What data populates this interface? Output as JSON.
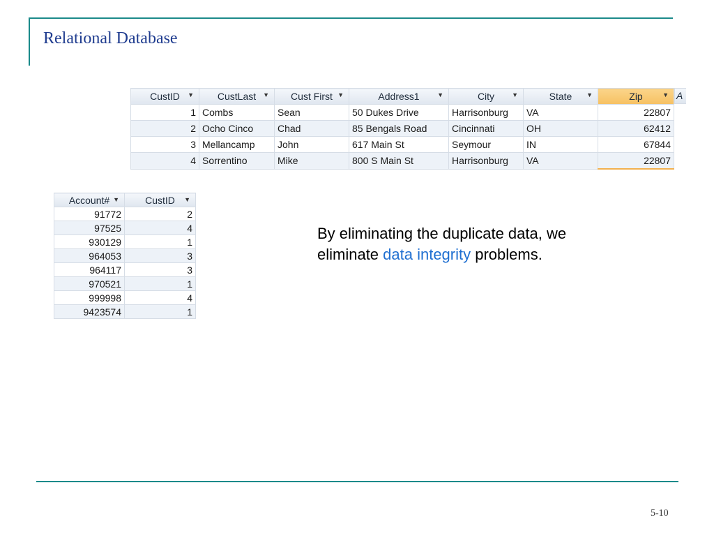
{
  "slide": {
    "title": "Relational Database",
    "page_number": "5-10",
    "note_before": "By eliminating the duplicate data, we eliminate ",
    "note_highlight": "data integrity",
    "note_after": " problems.",
    "accent_color": "#1b8a8a",
    "highlight_color": "#1f6fd1"
  },
  "customers": {
    "headers": [
      "CustID",
      "CustLast",
      "Cust First",
      "Address1",
      "City",
      "State",
      "Zip"
    ],
    "cut_header": "A",
    "rows": [
      [
        "1",
        "Combs",
        "Sean",
        "50 Dukes Drive",
        "Harrisonburg",
        "VA",
        "22807"
      ],
      [
        "2",
        "Ocho Cinco",
        "Chad",
        "85 Bengals Road",
        "Cincinnati",
        "OH",
        "62412"
      ],
      [
        "3",
        "Mellancamp",
        "John",
        "617 Main St",
        "Seymour",
        "IN",
        "67844"
      ],
      [
        "4",
        "Sorrentino",
        "Mike",
        "800 S Main St",
        "Harrisonburg",
        "VA",
        "22807"
      ]
    ]
  },
  "accounts": {
    "headers": [
      "Account#",
      "CustID"
    ],
    "rows": [
      [
        "91772",
        "2"
      ],
      [
        "97525",
        "4"
      ],
      [
        "930129",
        "1"
      ],
      [
        "964053",
        "3"
      ],
      [
        "964117",
        "3"
      ],
      [
        "970521",
        "1"
      ],
      [
        "999998",
        "4"
      ],
      [
        "9423574",
        "1"
      ]
    ]
  }
}
